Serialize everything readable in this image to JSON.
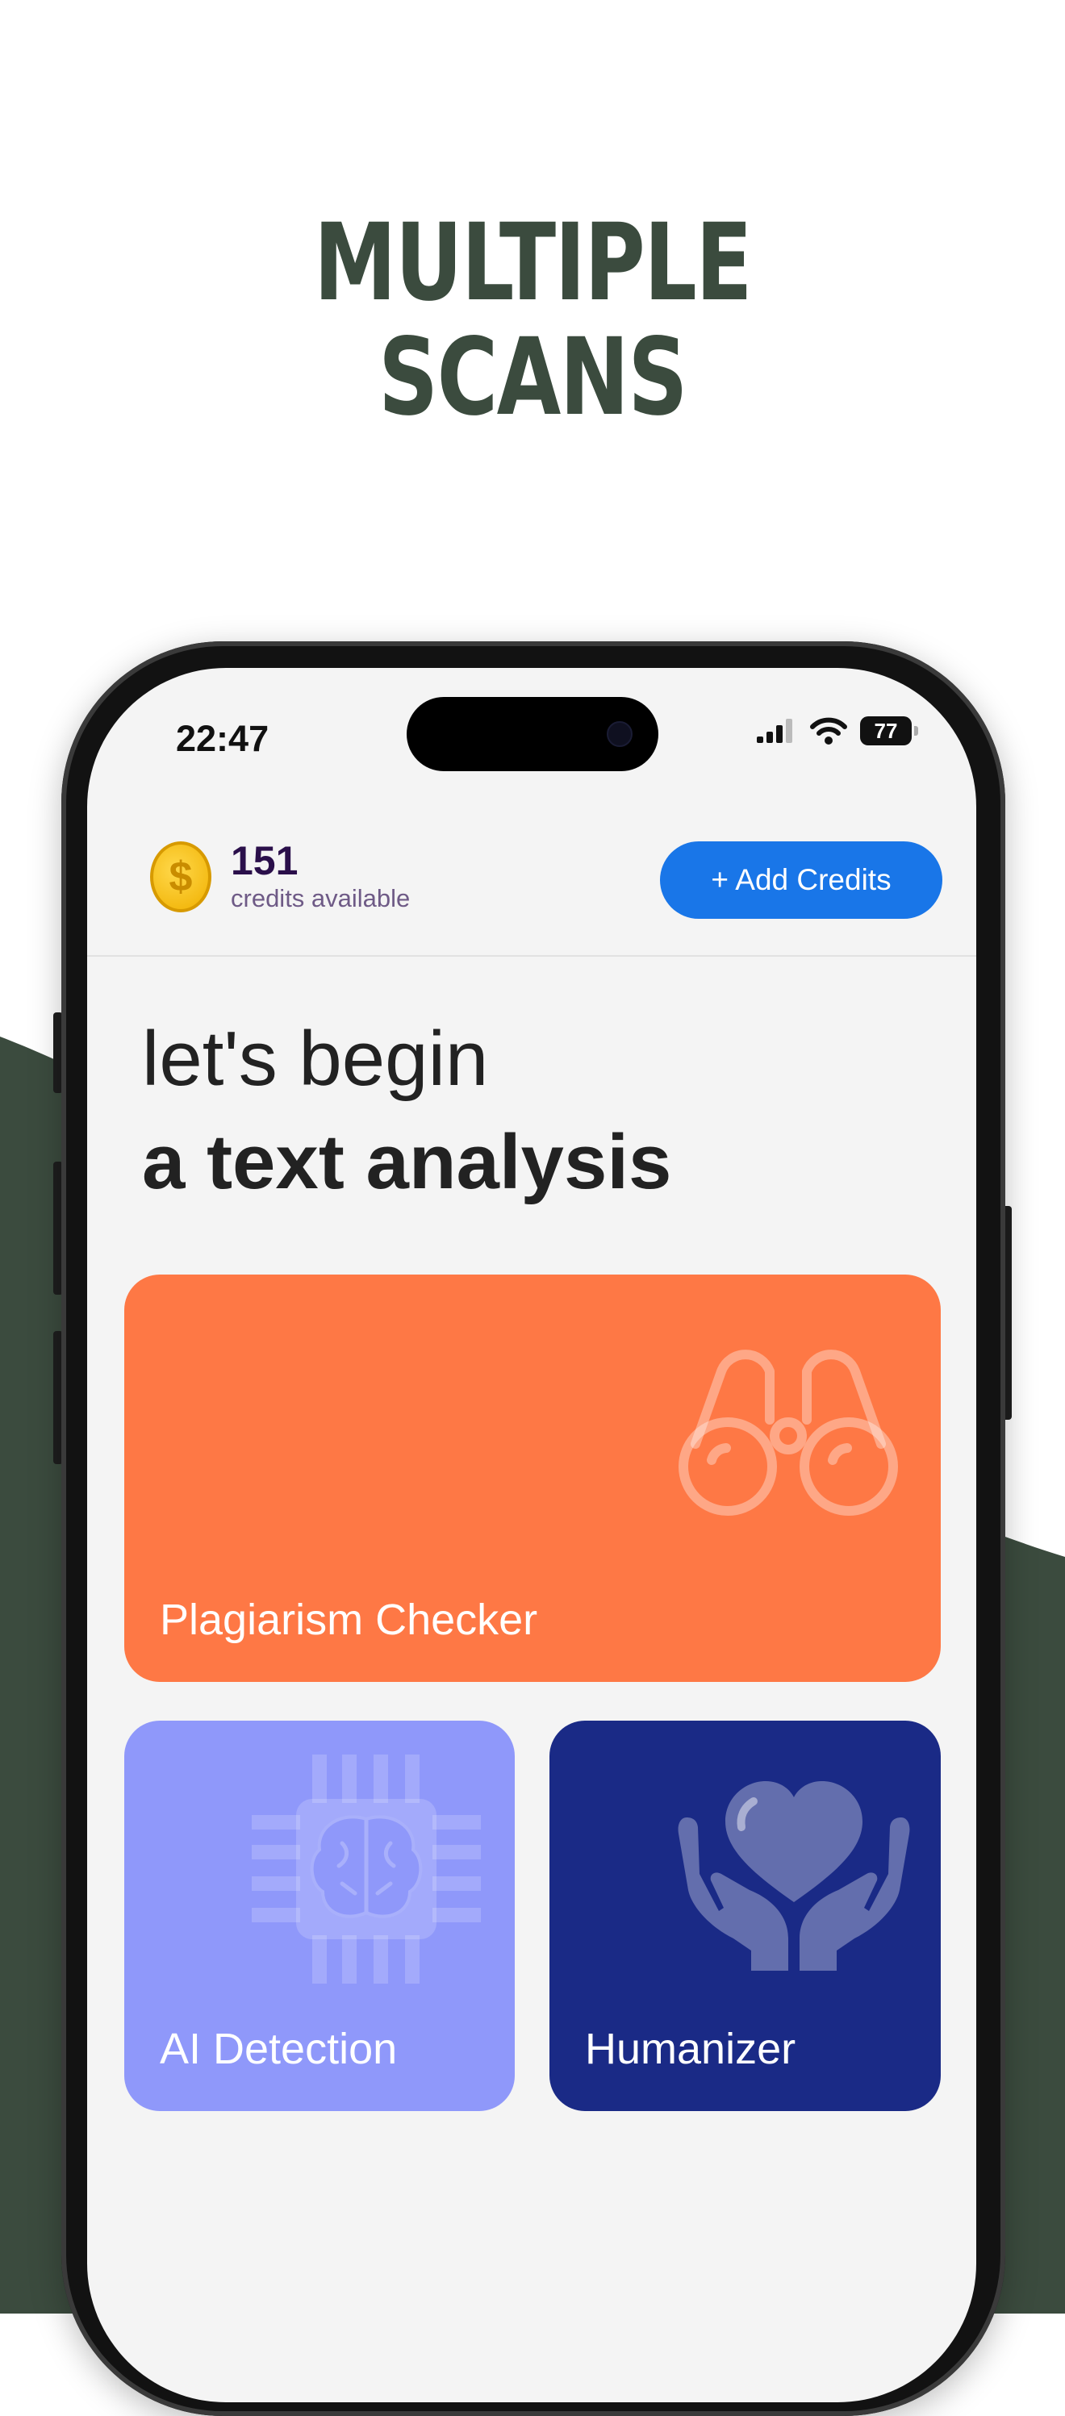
{
  "headline": {
    "line1": "MULTIPLE",
    "line2": "SCANS"
  },
  "status_bar": {
    "time": "22:47",
    "battery": "77"
  },
  "credits": {
    "count": "151",
    "label": "credits available"
  },
  "add_credits_label": "+ Add Credits",
  "greeting": {
    "line1": "let's begin",
    "line2": "a text analysis"
  },
  "cards": {
    "plagiarism": {
      "label": "Plagiarism Checker",
      "icon": "binoculars-icon",
      "color": "#fe7845"
    },
    "ai_detection": {
      "label": "AI Detection",
      "icon": "ai-chip-brain-icon",
      "color": "#8f98fa"
    },
    "humanizer": {
      "label": "Humanizer",
      "icon": "hands-heart-icon",
      "color": "#1a2a86"
    }
  },
  "colors": {
    "headline": "#3b4b3e",
    "background_shape": "#3b4b3e",
    "button": "#1976e8"
  }
}
